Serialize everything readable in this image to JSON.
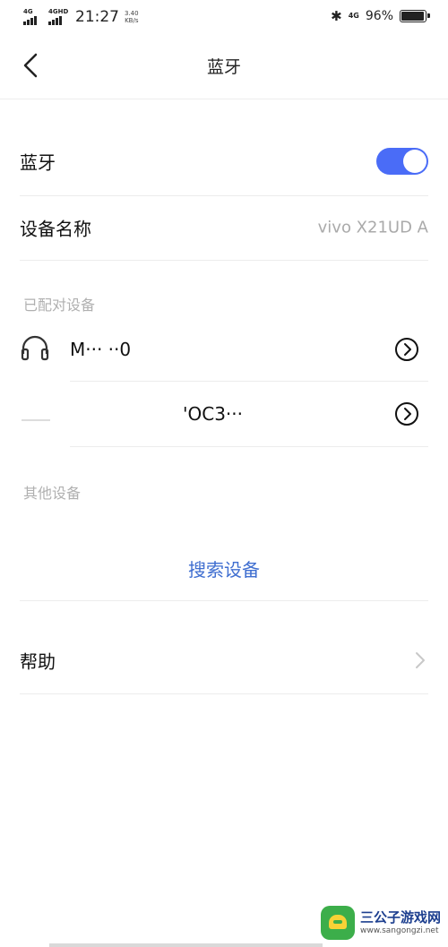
{
  "status_bar": {
    "sim1_network": "4G",
    "sim2_network": "4GHD",
    "time": "21:27",
    "speed_value": "3.40",
    "speed_unit": "KB/s",
    "mini_network": "4G",
    "battery_percent": "96%",
    "battery_level": 0.96
  },
  "header": {
    "title": "蓝牙"
  },
  "bluetooth": {
    "label": "蓝牙",
    "enabled": true,
    "toggle_color": "#4a6cf7"
  },
  "device_name": {
    "label": "设备名称",
    "value": "vivo X21UD A"
  },
  "paired_section": {
    "label": "已配对设备",
    "devices": [
      {
        "name": "M··· ··0"
      },
      {
        "name": "'OC3···"
      }
    ]
  },
  "other_section": {
    "label": "其他设备",
    "search_button": "搜索设备",
    "accent_color": "#3f6ed0"
  },
  "help": {
    "label": "帮助"
  },
  "watermark": {
    "title": "三公子游戏网",
    "url": "www.sangongzi.net"
  }
}
